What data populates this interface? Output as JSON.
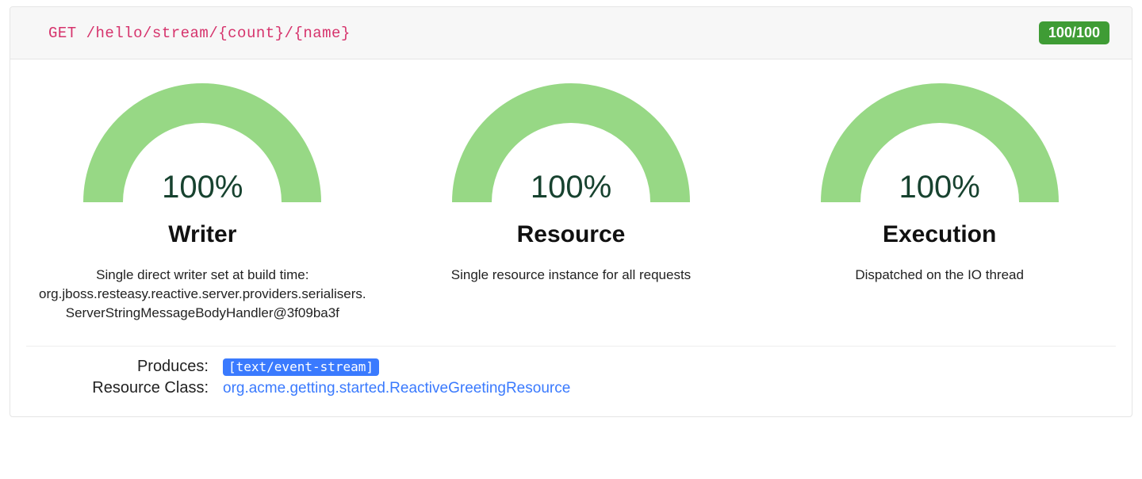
{
  "header": {
    "method_path": "GET /hello/stream/{count}/{name}",
    "score": "100/100"
  },
  "gauges": [
    {
      "percent": "100%",
      "title": "Writer",
      "desc": "Single direct writer set at build time: org.jboss.resteasy.reactive.server.providers.serialisers.ServerStringMessageBodyHandler@3f09ba3f"
    },
    {
      "percent": "100%",
      "title": "Resource",
      "desc": "Single resource instance for all requests"
    },
    {
      "percent": "100%",
      "title": "Execution",
      "desc": "Dispatched on the IO thread"
    }
  ],
  "meta": {
    "produces_label": "Produces:",
    "produces_value": "[text/event-stream]",
    "resource_class_label": "Resource Class:",
    "resource_class_value": "org.acme.getting.started.ReactiveGreetingResource"
  },
  "chart_data": [
    {
      "type": "gauge",
      "title": "Writer",
      "value": 100,
      "max": 100,
      "unit": "%"
    },
    {
      "type": "gauge",
      "title": "Resource",
      "value": 100,
      "max": 100,
      "unit": "%"
    },
    {
      "type": "gauge",
      "title": "Execution",
      "value": 100,
      "max": 100,
      "unit": "%"
    }
  ],
  "colors": {
    "arc_fill": "#97d885",
    "arc_track": "#ffffff",
    "accent": "#3a7afe",
    "score_bg": "#3f9c35",
    "endpoint": "#d6336c"
  }
}
